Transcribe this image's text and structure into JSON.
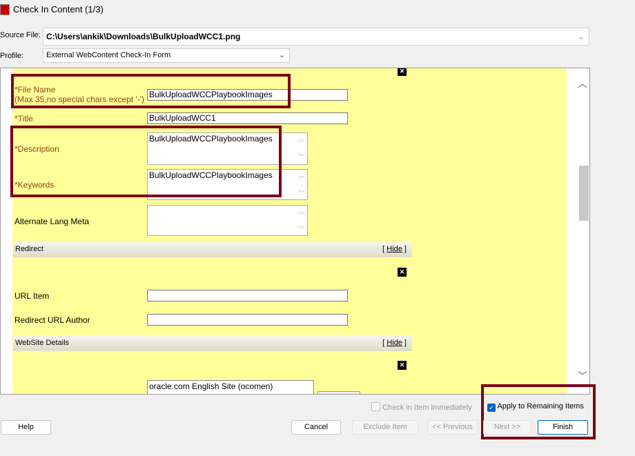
{
  "window": {
    "title": "Check In Content (1/3)"
  },
  "source_file": {
    "label": "Source File:",
    "value": "C:\\Users\\ankik\\Downloads\\BulkUploadWCC1.png"
  },
  "profile": {
    "label": "Profile:",
    "value": "External WebContent Check-In Form"
  },
  "form": {
    "file_name": {
      "label": "*File Name",
      "hint": "(Max 35,no special chars except '-')",
      "value": "BulkUploadWCCPlaybookImages"
    },
    "title": {
      "label": "*Title",
      "value": "BulkUploadWCC1"
    },
    "description": {
      "label": "*Description",
      "value": "BulkUploadWCCPlaybookImages"
    },
    "keywords": {
      "label": "*Keywords",
      "value": "BulkUploadWCCPlaybookImages"
    },
    "alt_lang": {
      "label": "Alternate Lang Meta",
      "value": ""
    },
    "redirect": {
      "header": "Redirect",
      "hide": "Hide",
      "url_item": {
        "label": "URL Item",
        "value": ""
      },
      "redirect_author": {
        "label": "Redirect URL Author",
        "value": ""
      }
    },
    "website": {
      "header": "WebSite Details",
      "hide": "Hide",
      "site_option": "oracle.com English Site (ocomen)"
    }
  },
  "options": {
    "check_in_immediately": {
      "label": "Check in Item Immediately",
      "checked": false,
      "enabled": false
    },
    "apply_remaining": {
      "label": "Apply to Remaining Items",
      "checked": true
    }
  },
  "buttons": {
    "help": "Help",
    "cancel": "Cancel",
    "exclude": "Exclude Item",
    "previous": "<< Previous",
    "next": "Next >>",
    "finish": "Finish"
  },
  "colors": {
    "form_bg": "#ffff99",
    "required_label": "#8b4513",
    "highlight": "#7d0019",
    "accent": "#0067c0"
  }
}
